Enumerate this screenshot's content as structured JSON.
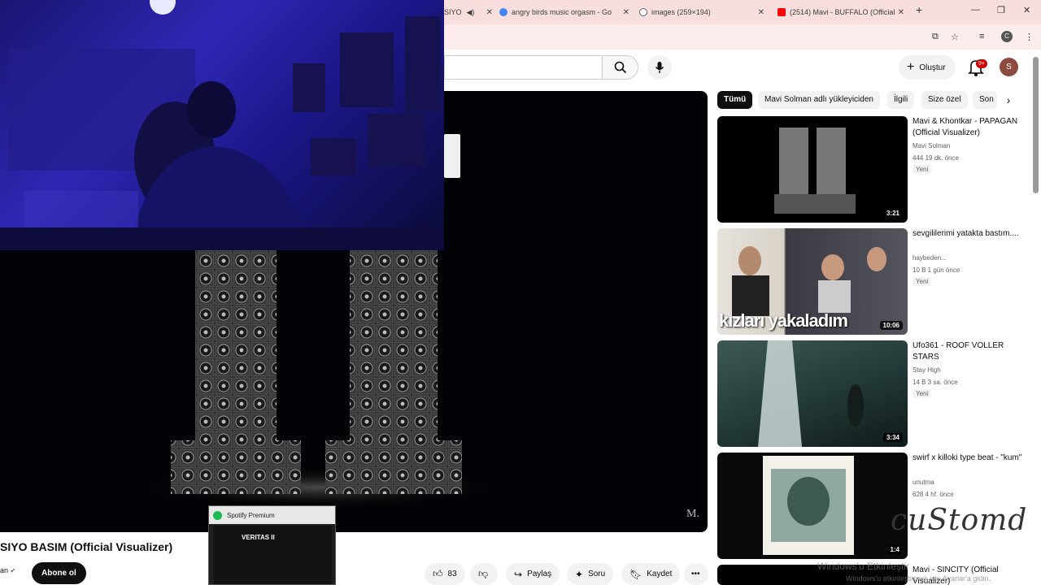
{
  "browser": {
    "tabs": [
      {
        "label": "SIYO",
        "icon": "speaker-icon",
        "color": "#ff0000"
      },
      {
        "label": "angry birds music orgasm - Go",
        "icon": "google-icon",
        "color": "#4285f4"
      },
      {
        "label": "images (259×194)",
        "icon": "globe-icon",
        "color": "#5f6368"
      },
      {
        "label": "(2514) Mavi - BUFFALO (Official",
        "icon": "youtube-icon",
        "color": "#ff0000"
      }
    ],
    "profile_letter": "C"
  },
  "header": {
    "create_label": "Oluştur",
    "notifications": "9+",
    "avatar_letter": "S"
  },
  "video": {
    "title": "SIYO BASIM (Official Visualizer)",
    "channel_name": "an",
    "subscribe_label": "Abone ol",
    "likes": "83",
    "share_label": "Paylaş",
    "ask_label": "Soru",
    "save_label": "Kaydet",
    "watermark": "M."
  },
  "spotify": {
    "window_title": "Spotify Premium",
    "track": "VERITAS II"
  },
  "chips": [
    "Tümü",
    "Mavi Solman adlı yükleyiciden",
    "İlgili",
    "Size özel",
    "Son"
  ],
  "recommendations": [
    {
      "title": "Mavi & Khontkar - PAPAGAN (Official Visualizer)",
      "channel": "Mavi Solman",
      "verified": true,
      "meta": "444  19 dk. önce",
      "badge": "Yeni",
      "duration": "3:21"
    },
    {
      "title": "sevgililerimi yatakta bastım....",
      "channel": "haybeden...",
      "verified": false,
      "meta": "10 B  1 gün önce",
      "badge": "Yeni",
      "duration": "10:06",
      "thumb_caption": "kızları yakaladım"
    },
    {
      "title": "Ufo361 - ROOF VOLLER STARS",
      "channel": "Stay High",
      "verified": true,
      "meta": "14 B  3 sa. önce",
      "badge": "Yeni",
      "duration": "3:34"
    },
    {
      "title": "swirf x killoki type beat - \"kum\"",
      "channel": "unutma",
      "verified": false,
      "meta": "628  4 hf. önce",
      "badge": "",
      "duration": "1:4"
    },
    {
      "title": "Mavi - SINCITY (Official Visualizer)",
      "channel": "",
      "verified": false,
      "meta": "",
      "badge": "",
      "duration": ""
    }
  ],
  "overlay": {
    "signature": "cuStomd",
    "activate_line1": "Windows'u Etkinleştir",
    "activate_line2": "Windows'u etkinleştirmek için Ayarlar'a gidin."
  }
}
